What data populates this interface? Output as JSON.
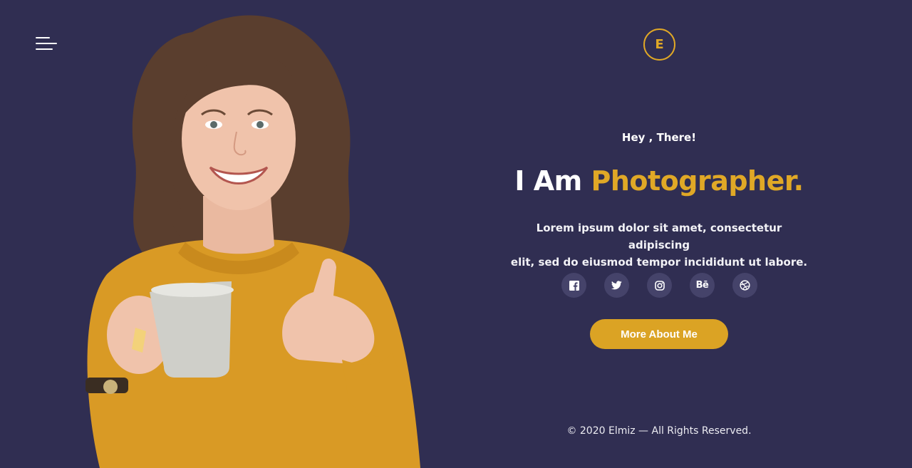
{
  "header": {
    "logo_letter": "E"
  },
  "hero": {
    "greeting": "Hey , There!",
    "headline_prefix": "I Am ",
    "headline_accent": "Photographer.",
    "description_line1": "Lorem ipsum dolor sit amet, consectetur adipiscing",
    "description_line2": "elit, sed do eiusmod tempor incididunt ut labore.",
    "cta_label": "More About Me"
  },
  "socials": [
    {
      "icon": "facebook-icon"
    },
    {
      "icon": "twitter-icon"
    },
    {
      "icon": "instagram-icon"
    },
    {
      "icon": "behance-icon",
      "text": "Bē"
    },
    {
      "icon": "dribbble-icon"
    }
  ],
  "footer": {
    "copyright": "© 2020 Elmiz — All Rights Reserved."
  },
  "colors": {
    "background": "#302e52",
    "accent": "#e0a826",
    "button": "#dba324",
    "social_bg": "#45436a"
  }
}
